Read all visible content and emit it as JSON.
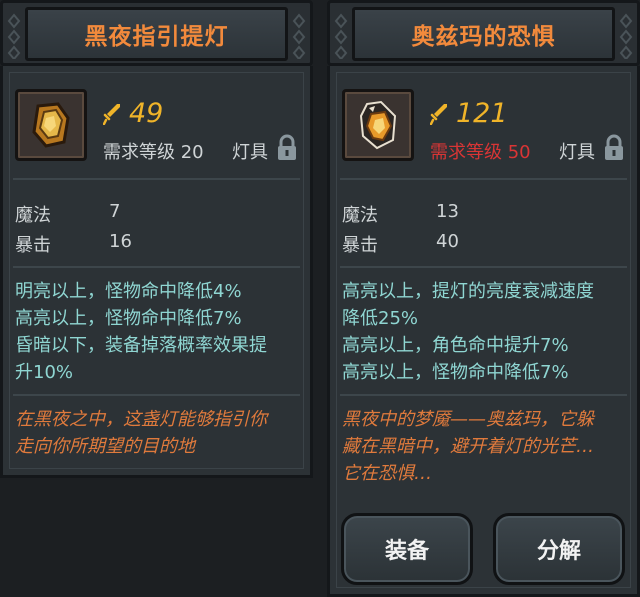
{
  "left_card": {
    "title": "黑夜指引提灯",
    "damage": "49",
    "required_level": "需求等级 20",
    "slot_type": "灯具",
    "stats": [
      {
        "name": "魔法",
        "value": "7"
      },
      {
        "name": "暴击",
        "value": "16"
      }
    ],
    "effects": [
      "明亮以上，怪物命中降低4%",
      "高亮以上，怪物命中降低7%",
      "昏暗以下，装备掉落概率效果提",
      "升10%"
    ],
    "lore": [
      "在黑夜之中，这盏灯能够指引你",
      "走向你所期望的目的地"
    ]
  },
  "right_card": {
    "title": "奥兹玛的恐惧",
    "damage": "121",
    "required_level": "需求等级 50",
    "slot_type": "灯具",
    "stats": [
      {
        "name": "魔法",
        "value": "13"
      },
      {
        "name": "暴击",
        "value": "40"
      }
    ],
    "effects": [
      "高亮以上，提灯的亮度衰减速度",
      "降低25%",
      "高亮以上，角色命中提升7%",
      "高亮以上，怪物命中降低7%"
    ],
    "lore": [
      "黑夜中的梦魇——奥兹玛，它躲",
      "藏在黑暗中，避开着灯的光芒…",
      "它在恐惧…"
    ],
    "buttons": {
      "equip": "装备",
      "salvage": "分解"
    }
  },
  "colors": {
    "title": "#f28a3c",
    "damage": "#f0b429",
    "effect_text": "#8fd6d2",
    "lore_text": "#e07a3c",
    "level_unmet": "#d93535"
  }
}
